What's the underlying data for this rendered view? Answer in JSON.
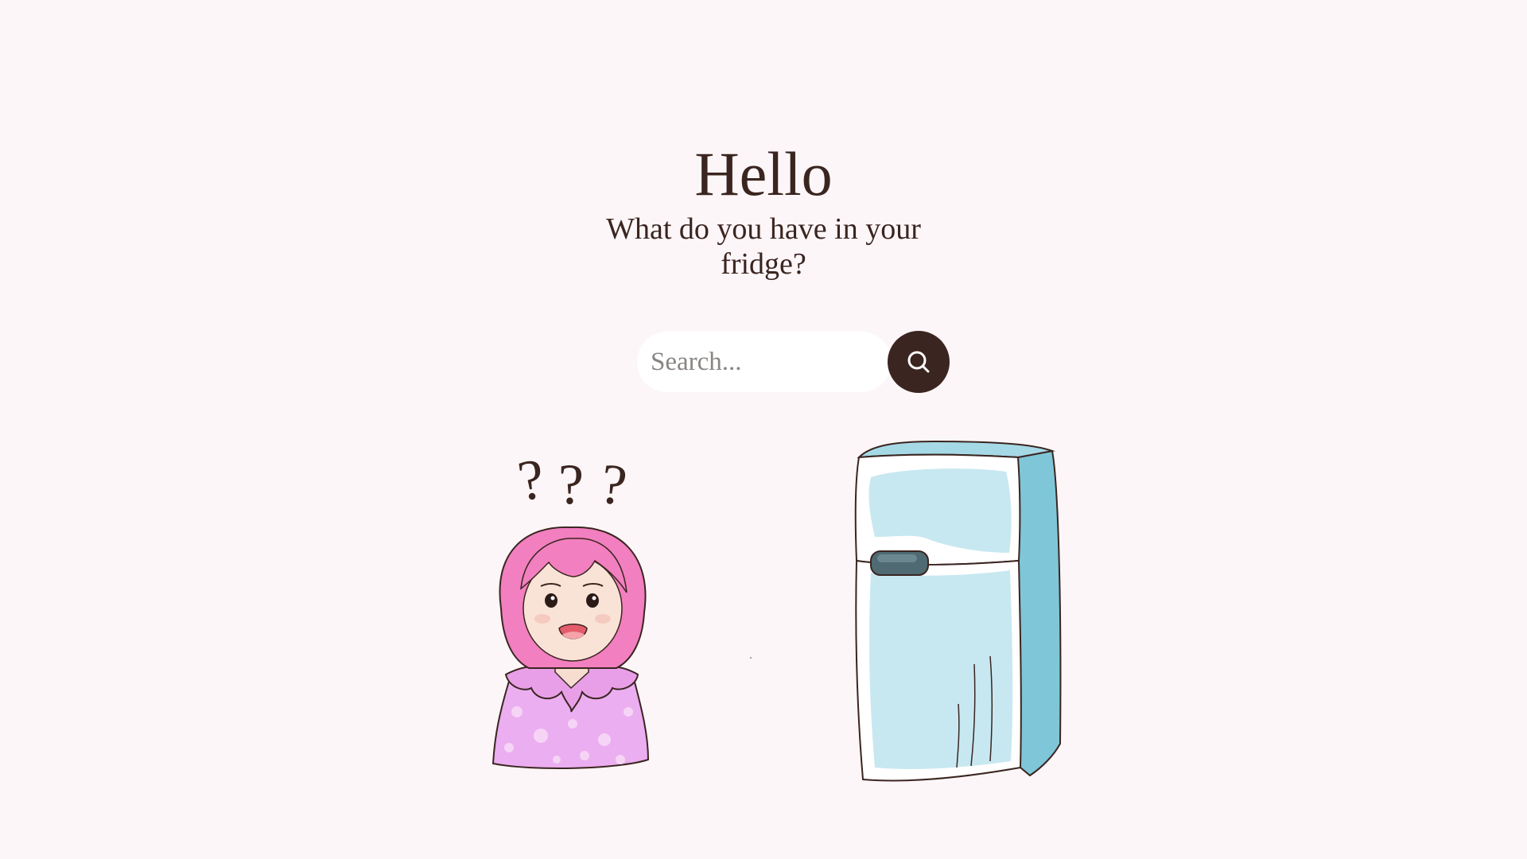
{
  "hero": {
    "title": "Hello",
    "subtitle": "What do you have in your fridge?"
  },
  "search": {
    "placeholder": "Search...",
    "value": "",
    "button_icon": "search-icon"
  },
  "illustrations": {
    "girl": "confused-girl-illustration",
    "girl_marks": [
      "?",
      "?",
      "?"
    ],
    "fridge": "fridge-illustration"
  },
  "colors": {
    "background": "#fdf6f8",
    "text": "#3a2520",
    "button": "#3b2520",
    "hair": "#f27fbf",
    "dress": "#ebaef0",
    "fridge_body": "#c8e8f1",
    "fridge_side": "#7fc6d8"
  }
}
